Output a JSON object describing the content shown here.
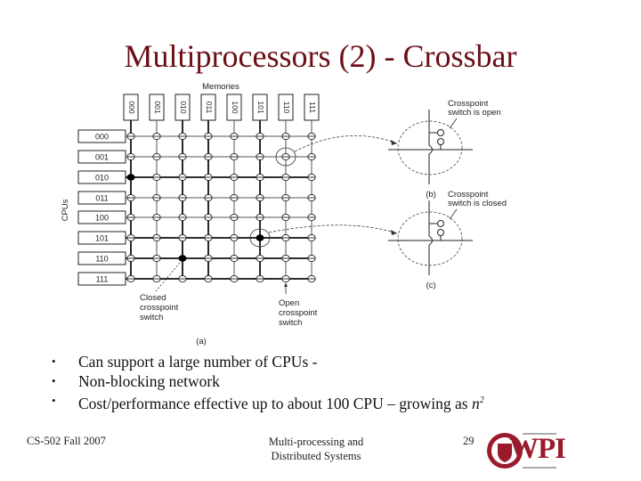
{
  "slide": {
    "title": "Multiprocessors (2) - Crossbar",
    "title_color": "#6b0f16"
  },
  "figure": {
    "memories_label": "Memories",
    "cpus_label": "CPUs",
    "memory_ids": [
      "000",
      "001",
      "010",
      "011",
      "100",
      "101",
      "110",
      "111"
    ],
    "cpu_ids": [
      "000",
      "001",
      "010",
      "011",
      "100",
      "101",
      "110",
      "111"
    ],
    "closed_crosspoints": [
      {
        "cpu": "010",
        "memory": "000"
      },
      {
        "cpu": "101",
        "memory": "101"
      },
      {
        "cpu": "110",
        "memory": "010"
      }
    ],
    "highlighted_open": {
      "cpu": "001",
      "memory": "110"
    },
    "highlighted_closed": {
      "cpu": "101",
      "memory": "101"
    },
    "closed_label": [
      "Closed",
      "crosspoint",
      "switch"
    ],
    "open_label": [
      "Open",
      "crosspoint",
      "switch"
    ],
    "panel_a_label": "(a)",
    "panel_b": {
      "caption": [
        "Crosspoint",
        "switch is open"
      ],
      "label": "(b)"
    },
    "panel_c": {
      "caption": [
        "Crosspoint",
        "switch is closed"
      ],
      "label": "(c)"
    }
  },
  "bullets": [
    {
      "text": "Can support a large number of CPUs -"
    },
    {
      "text": "Non-blocking network"
    },
    {
      "text": "Cost/performance effective up to about 100 CPU – growing as ",
      "var": "n",
      "sup": "2"
    }
  ],
  "bullet_glyph": "•",
  "footer": {
    "course": "CS-502 Fall 2007",
    "center_line1": "Multi-processing and",
    "center_line2": "Distributed Systems",
    "page_number": "29",
    "logo_text": "WPI",
    "logo_color": "#9b1b2c"
  }
}
